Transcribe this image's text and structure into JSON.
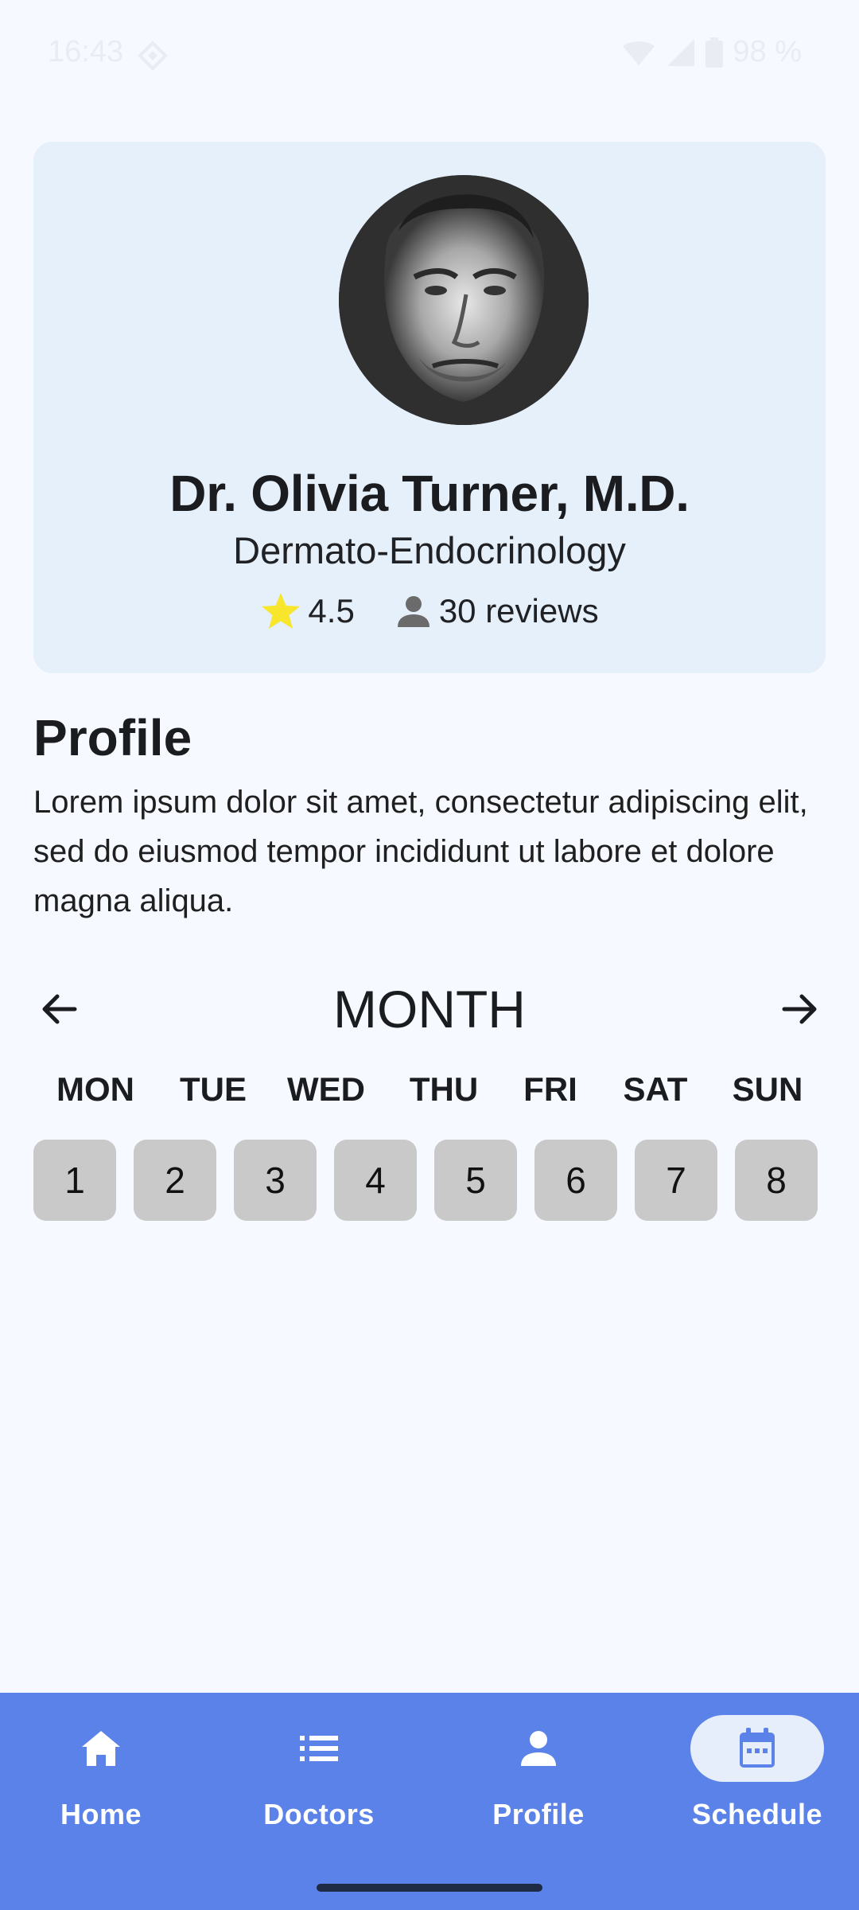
{
  "status": {
    "time": "16:43",
    "battery": "98 %"
  },
  "doctor": {
    "name": "Dr. Olivia Turner, M.D.",
    "specialty": "Dermato-Endocrinology",
    "rating": "4.5",
    "reviews": "30 reviews"
  },
  "profile": {
    "title": "Profile",
    "description": "Lorem ipsum dolor sit amet, consectetur adipiscing elit, sed do eiusmod tempor incididunt ut labore et dolore magna aliqua."
  },
  "calendar": {
    "month": "MONTH",
    "weekdays": [
      "MON",
      "TUE",
      "WED",
      "THU",
      "FRI",
      "SAT",
      "SUN"
    ],
    "dates": [
      "1",
      "2",
      "3",
      "4",
      "5",
      "6",
      "7",
      "8"
    ]
  },
  "nav": {
    "items": [
      {
        "label": "Home",
        "icon": "home-icon"
      },
      {
        "label": "Doctors",
        "icon": "list-icon"
      },
      {
        "label": "Profile",
        "icon": "person-icon"
      },
      {
        "label": "Schedule",
        "icon": "calendar-icon"
      }
    ],
    "active": "Schedule"
  },
  "colors": {
    "background": "#f6f9ff",
    "card": "#e5f0fb",
    "nav": "#5b82e8",
    "date_box": "#c9c9c9",
    "star": "#f7e62b"
  }
}
